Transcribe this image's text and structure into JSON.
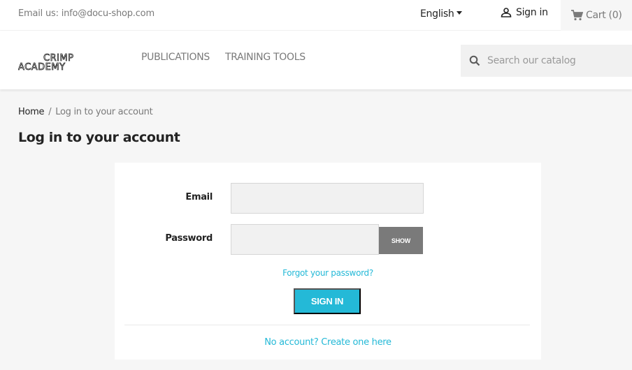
{
  "topbar": {
    "email_text": "Email us: info@docu-shop.com",
    "language": "English",
    "signin_label": "Sign in",
    "cart_label": "Cart (0)"
  },
  "header": {
    "logo_top": "CRIMP",
    "logo_bottom": "ACADEMY",
    "menu": [
      "PUBLICATIONS",
      "TRAINING TOOLS"
    ],
    "search_placeholder": "Search our catalog"
  },
  "breadcrumb": {
    "home": "Home",
    "separator": "/",
    "current": "Log in to your account"
  },
  "page_title": "Log in to your account",
  "login_form": {
    "email_label": "Email",
    "email_value": "",
    "password_label": "Password",
    "password_value": "",
    "show_label": "SHOW",
    "forgot_label": "Forgot your password?",
    "submit_label": "SIGN IN",
    "create_label": "No account? Create one here"
  },
  "icons": {
    "user": "user-icon",
    "cart": "shopping-cart-icon",
    "search": "search-icon",
    "caret": "caret-down-icon"
  },
  "colors": {
    "accent": "#24b9d7",
    "text_dark": "#232323",
    "text_muted": "#7a7a7a",
    "background": "#f6f6f6",
    "show_button": "#7a7a7a"
  }
}
